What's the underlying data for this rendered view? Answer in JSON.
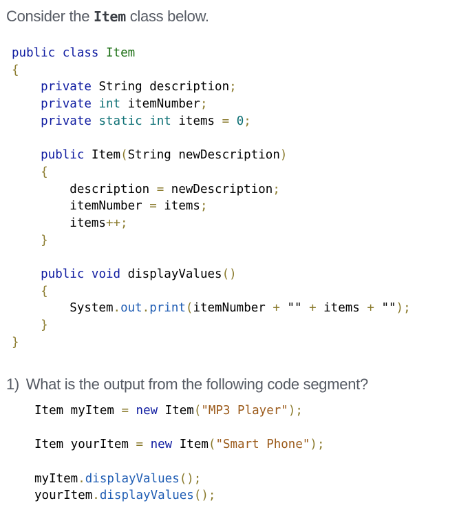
{
  "intro": {
    "prefix": "Consider the ",
    "code": "Item",
    "suffix": " class below."
  },
  "class_code": {
    "lines": [
      [
        {
          "t": "public",
          "c": "kw"
        },
        {
          "t": " "
        },
        {
          "t": "class",
          "c": "kw"
        },
        {
          "t": " "
        },
        {
          "t": "Item",
          "c": "cls"
        }
      ],
      [
        {
          "t": "{",
          "c": "punc"
        }
      ],
      [
        {
          "t": "    "
        },
        {
          "t": "private",
          "c": "kw"
        },
        {
          "t": " String description"
        },
        {
          "t": ";",
          "c": "punc"
        }
      ],
      [
        {
          "t": "    "
        },
        {
          "t": "private",
          "c": "kw"
        },
        {
          "t": " "
        },
        {
          "t": "int",
          "c": "kw2"
        },
        {
          "t": " itemNumber"
        },
        {
          "t": ";",
          "c": "punc"
        }
      ],
      [
        {
          "t": "    "
        },
        {
          "t": "private",
          "c": "kw"
        },
        {
          "t": " "
        },
        {
          "t": "static",
          "c": "kw2"
        },
        {
          "t": " "
        },
        {
          "t": "int",
          "c": "kw2"
        },
        {
          "t": " items "
        },
        {
          "t": "=",
          "c": "punc"
        },
        {
          "t": " "
        },
        {
          "t": "0",
          "c": "num"
        },
        {
          "t": ";",
          "c": "punc"
        }
      ],
      [],
      [
        {
          "t": "    "
        },
        {
          "t": "public",
          "c": "kw"
        },
        {
          "t": " Item"
        },
        {
          "t": "(",
          "c": "punc"
        },
        {
          "t": "String newDescription"
        },
        {
          "t": ")",
          "c": "punc"
        }
      ],
      [
        {
          "t": "    "
        },
        {
          "t": "{",
          "c": "punc"
        }
      ],
      [
        {
          "t": "        description "
        },
        {
          "t": "=",
          "c": "punc"
        },
        {
          "t": " newDescription"
        },
        {
          "t": ";",
          "c": "punc"
        }
      ],
      [
        {
          "t": "        itemNumber "
        },
        {
          "t": "=",
          "c": "punc"
        },
        {
          "t": " items"
        },
        {
          "t": ";",
          "c": "punc"
        }
      ],
      [
        {
          "t": "        items"
        },
        {
          "t": "++;",
          "c": "punc"
        }
      ],
      [
        {
          "t": "    "
        },
        {
          "t": "}",
          "c": "punc"
        }
      ],
      [],
      [
        {
          "t": "    "
        },
        {
          "t": "public",
          "c": "kw"
        },
        {
          "t": " "
        },
        {
          "t": "void",
          "c": "kw"
        },
        {
          "t": " displayValues"
        },
        {
          "t": "()",
          "c": "punc"
        }
      ],
      [
        {
          "t": "    "
        },
        {
          "t": "{",
          "c": "punc"
        }
      ],
      [
        {
          "t": "        System"
        },
        {
          "t": ".",
          "c": "punc"
        },
        {
          "t": "out",
          "c": "mth"
        },
        {
          "t": ".",
          "c": "punc"
        },
        {
          "t": "print",
          "c": "mth"
        },
        {
          "t": "(",
          "c": "punc"
        },
        {
          "t": "itemNumber "
        },
        {
          "t": "+",
          "c": "punc"
        },
        {
          "t": " \"\" "
        },
        {
          "t": "+",
          "c": "punc"
        },
        {
          "t": " items "
        },
        {
          "t": "+",
          "c": "punc"
        },
        {
          "t": " \"\""
        },
        {
          "t": ");",
          "c": "punc"
        }
      ],
      [
        {
          "t": "    "
        },
        {
          "t": "}",
          "c": "punc"
        }
      ],
      [
        {
          "t": "}",
          "c": "punc"
        }
      ]
    ]
  },
  "question": {
    "number": "1)",
    "text": "What is the output from the following code segment?"
  },
  "segment_code": {
    "lines": [
      [
        {
          "t": "Item myItem "
        },
        {
          "t": "=",
          "c": "punc"
        },
        {
          "t": " "
        },
        {
          "t": "new",
          "c": "kw"
        },
        {
          "t": " Item"
        },
        {
          "t": "(",
          "c": "punc"
        },
        {
          "t": "\"MP3 Player\"",
          "c": "str"
        },
        {
          "t": ");",
          "c": "punc"
        }
      ],
      [],
      [
        {
          "t": "Item yourItem "
        },
        {
          "t": "=",
          "c": "punc"
        },
        {
          "t": " "
        },
        {
          "t": "new",
          "c": "kw"
        },
        {
          "t": " Item"
        },
        {
          "t": "(",
          "c": "punc"
        },
        {
          "t": "\"Smart Phone\"",
          "c": "str"
        },
        {
          "t": ");",
          "c": "punc"
        }
      ],
      [],
      [
        {
          "t": "myItem"
        },
        {
          "t": ".",
          "c": "punc"
        },
        {
          "t": "displayValues",
          "c": "mth"
        },
        {
          "t": "();",
          "c": "punc"
        }
      ],
      [
        {
          "t": "yourItem"
        },
        {
          "t": ".",
          "c": "punc"
        },
        {
          "t": "displayValues",
          "c": "mth"
        },
        {
          "t": "();",
          "c": "punc"
        }
      ]
    ]
  }
}
